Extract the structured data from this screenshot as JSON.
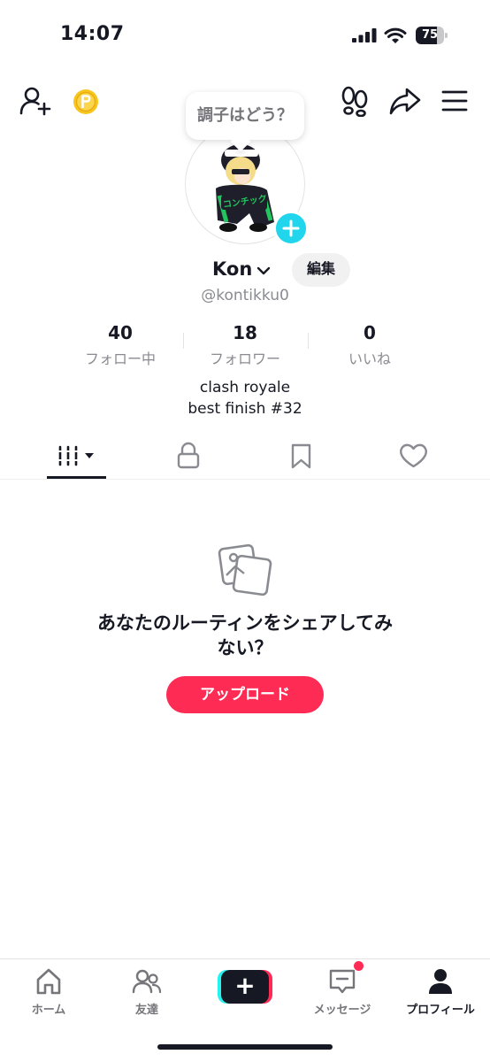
{
  "status_bar": {
    "time": "14:07",
    "battery_level": "75",
    "icons": [
      "signal-icon",
      "wifi-icon",
      "battery-icon"
    ]
  },
  "top_nav": {
    "icons": [
      "add-friend-icon",
      "coin-icon",
      "footprint-icon",
      "share-icon",
      "menu-icon"
    ],
    "coin_color": "#f9c51d"
  },
  "profile": {
    "bubble_text": "調子はどう？",
    "username": "Kon",
    "edit_label": "編集",
    "handle": "@kontikku0",
    "avatar_text": "コンチック",
    "stats": [
      {
        "value": "40",
        "label": "フォロー中"
      },
      {
        "value": "18",
        "label": "フォロワー"
      },
      {
        "value": "0",
        "label": "いいね"
      }
    ],
    "bio_lines": [
      "clash royale",
      "best finish #32"
    ]
  },
  "tabs": [
    {
      "icon": "grid-icon",
      "active": true
    },
    {
      "icon": "lock-icon",
      "active": false
    },
    {
      "icon": "bookmark-icon",
      "active": false
    },
    {
      "icon": "heart-icon",
      "active": false
    }
  ],
  "empty_state": {
    "icon": "photo-icon",
    "title": "あなたのルーティンをシェアしてみない？",
    "button_label": "アップロード"
  },
  "bottom_nav": {
    "items": [
      {
        "label": "ホーム",
        "icon": "home-icon",
        "active": false
      },
      {
        "label": "友達",
        "icon": "friends-icon",
        "active": false
      },
      {
        "label": "",
        "icon": "create-icon",
        "active": false
      },
      {
        "label": "メッセージ",
        "icon": "inbox-icon",
        "active": false,
        "has_badge": true
      },
      {
        "label": "プロフィール",
        "icon": "profile-icon",
        "active": true
      }
    ]
  },
  "colors": {
    "accent": "#fe2c55",
    "cyan": "#20d5ec",
    "text": "#161823",
    "secondary": "#8a8b91"
  }
}
